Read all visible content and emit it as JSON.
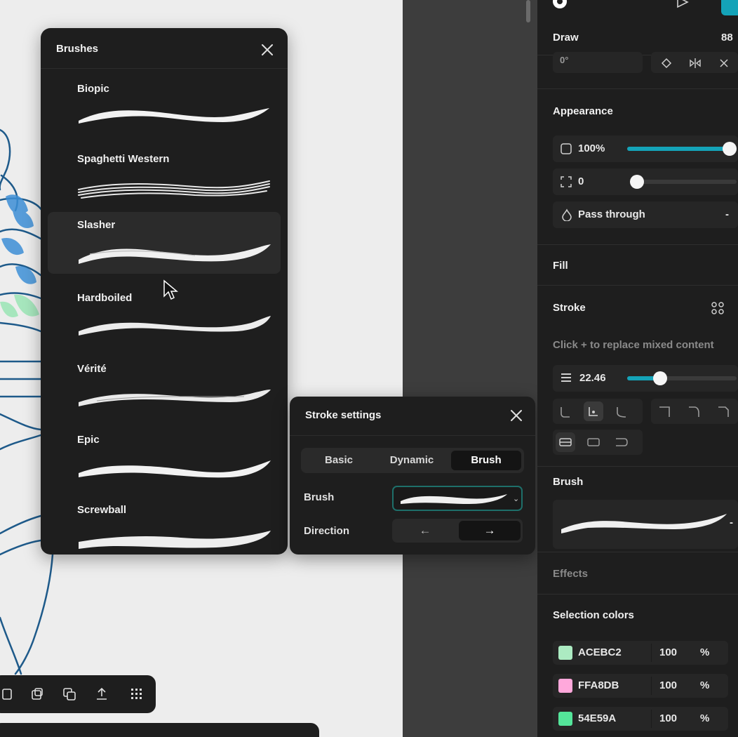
{
  "brushes_panel": {
    "title": "Brushes",
    "items": [
      {
        "name": "Biopic"
      },
      {
        "name": "Spaghetti Western"
      },
      {
        "name": "Slasher"
      },
      {
        "name": "Hardboiled"
      },
      {
        "name": "Vérité"
      },
      {
        "name": "Epic"
      },
      {
        "name": "Screwball"
      }
    ],
    "selected": "Slasher"
  },
  "stroke_settings": {
    "title": "Stroke settings",
    "tabs": [
      "Basic",
      "Dynamic",
      "Brush"
    ],
    "active_tab": "Brush",
    "brush_label": "Brush",
    "direction_label": "Direction",
    "direction_left": "←",
    "direction_right": "→",
    "direction_selected": "right"
  },
  "right_panel": {
    "header": "Draw",
    "header_right": "88",
    "rotation_value": "0°",
    "appearance": {
      "title": "Appearance",
      "opacity": "100%",
      "opacity_level": 1.0,
      "corner": "0",
      "corner_level": 0.0,
      "blend_mode": "Pass through",
      "blend_chevron": "-"
    },
    "fill": {
      "title": "Fill"
    },
    "stroke": {
      "title": "Stroke",
      "hint": "Click + to replace mixed content",
      "weight": "22.46",
      "weight_level": 0.3
    },
    "brush": {
      "title": "Brush",
      "chevron": "-"
    },
    "effects": {
      "title": "Effects"
    },
    "selection_colors": {
      "title": "Selection colors",
      "colors": [
        {
          "hex": "ACEBC2",
          "swatch": "#ACEBC2",
          "opacity": "100",
          "unit": "%"
        },
        {
          "hex": "FFA8DB",
          "swatch": "#FFA8DB",
          "opacity": "100",
          "unit": "%"
        },
        {
          "hex": "54E59A",
          "swatch": "#54E59A",
          "opacity": "100",
          "unit": "%"
        }
      ]
    }
  },
  "colors": {
    "accent": "#14a3b8",
    "panel": "#1e1e1e",
    "canvas": "#ededed",
    "sketch_blue": "#1e5a8a"
  },
  "toolbar_icons": [
    "copy-icon",
    "paste-icon",
    "duplicate-icon",
    "export-icon",
    "grid-icon"
  ]
}
